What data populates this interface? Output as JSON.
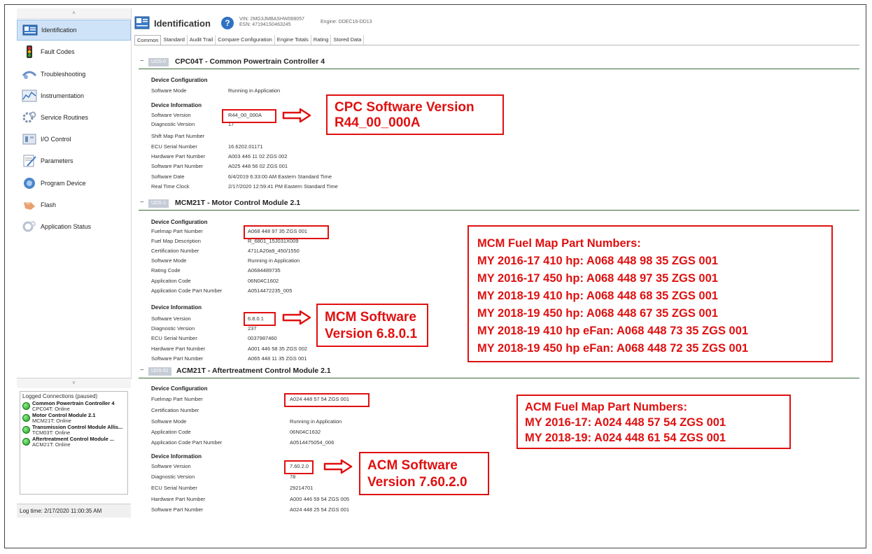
{
  "sidebar": {
    "items": [
      {
        "label": "Identification",
        "icon": "identification-icon",
        "active": true
      },
      {
        "label": "Fault Codes",
        "icon": "fault-codes-icon"
      },
      {
        "label": "Troubleshooting",
        "icon": "troubleshooting-icon"
      },
      {
        "label": "Instrumentation",
        "icon": "instrumentation-icon"
      },
      {
        "label": "Service Routines",
        "icon": "service-routines-icon"
      },
      {
        "label": "I/O Control",
        "icon": "io-control-icon"
      },
      {
        "label": "Parameters",
        "icon": "parameters-icon"
      },
      {
        "label": "Program Device",
        "icon": "program-device-icon"
      },
      {
        "label": "Flash",
        "icon": "flash-icon"
      },
      {
        "label": "Application Status",
        "icon": "application-status-icon"
      }
    ],
    "collapse_top": "˄",
    "collapse_bottom": "˅"
  },
  "connections": {
    "title": "Logged Connections (paused)",
    "items": [
      {
        "name": "Common Powertrain Controller 4",
        "status": "CPC04T: Online"
      },
      {
        "name": "Motor Control Module 2.1",
        "status": "MCM21T: Online"
      },
      {
        "name": "Transmission Control Module Allis...",
        "status": "TCM03T: Online"
      },
      {
        "name": "Aftertreatment Control Module ...",
        "status": "ACM21T: Online"
      }
    ]
  },
  "log_time": "Log time: 2/17/2020 11:00:35 AM",
  "header": {
    "title": "Identification",
    "help": "?",
    "vin": "VIN: 2MG3JMBASHW068057",
    "esn": "ESN: 471941S0463245",
    "engine": "Engine: DDEC16-DD13"
  },
  "tabs": [
    "Common",
    "Standard",
    "Audit Trail",
    "Compare Configuration",
    "Engine Totals",
    "Rating",
    "Stored Data"
  ],
  "cpc": {
    "minus": "−",
    "badge": "UDS-0",
    "title": "CPC04T - Common Powertrain Controller 4",
    "config_title": "Device Configuration",
    "config_rows": [
      {
        "label": "Software Mode",
        "value": "Running in Application"
      }
    ],
    "info_title": "Device Information",
    "info_rows": [
      {
        "label": "Software Version",
        "value": "R44_00_000A"
      },
      {
        "label": "Diagnostic Version",
        "value": "17"
      },
      {
        "label": "Shift Map Part Number",
        "value": ""
      },
      {
        "label": "ECU Serial Number",
        "value": "16.6202.01171"
      },
      {
        "label": "Hardware Part Number",
        "value": "A003 446 11 02 ZGS 002"
      },
      {
        "label": "Software Part Number",
        "value": "A025 448 56 02 ZGS 001"
      },
      {
        "label": "Software Date",
        "value": "6/4/2019 6:33:00 AM Eastern Standard Time"
      },
      {
        "label": "Real Time Clock",
        "value": "2/17/2020 12:59:41 PM Eastern Standard Time"
      }
    ]
  },
  "mcm": {
    "minus": "−",
    "badge": "UDS-1",
    "title": "MCM21T - Motor Control Module 2.1",
    "config_title": "Device Configuration",
    "config_rows": [
      {
        "label": "Fuelmap Part Number",
        "value": "A068 448 97 35 ZGS 001"
      },
      {
        "label": "Fuel Map Description",
        "value": "R_6801_15J031X009"
      },
      {
        "label": "Certification Number",
        "value": "471LA20a9_450/1550"
      },
      {
        "label": "Software Mode",
        "value": "Running in Application"
      },
      {
        "label": "Rating Code",
        "value": "A0684489735"
      },
      {
        "label": "Application Code",
        "value": "06N04C1602"
      },
      {
        "label": "Application Code Part Number",
        "value": "A0514472235_005"
      }
    ],
    "info_title": "Device Information",
    "info_rows": [
      {
        "label": "Software Version",
        "value": "6.8.0.1"
      },
      {
        "label": "Diagnostic Version",
        "value": "237"
      },
      {
        "label": "ECU Serial Number",
        "value": "0037987460"
      },
      {
        "label": "Hardware Part Number",
        "value": "A001 446 58 35 ZGS 002"
      },
      {
        "label": "Software Part Number",
        "value": "A065 448 11 35 ZGS 001"
      }
    ]
  },
  "acm": {
    "minus": "−",
    "badge": "UDS-61",
    "title": "ACM21T - Aftertreatment Control Module 2.1",
    "config_title": "Device Configuration",
    "config_rows": [
      {
        "label": "Fuelmap Part Number",
        "value": "A024 448 57 54 ZGS 001"
      },
      {
        "label": "Certification Number",
        "value": ""
      },
      {
        "label": "Software Mode",
        "value": "Running in Application"
      },
      {
        "label": "Application Code",
        "value": "06N04C1632"
      },
      {
        "label": "Application Code Part Number",
        "value": "A0514475054_006"
      }
    ],
    "info_title": "Device Information",
    "info_rows": [
      {
        "label": "Software Version",
        "value": "7.60.2.0"
      },
      {
        "label": "Diagnostic Version",
        "value": "78"
      },
      {
        "label": "ECU Serial Number",
        "value": "29214701"
      },
      {
        "label": "Hardware Part Number",
        "value": "A000 446 59 54 ZGS 005"
      },
      {
        "label": "Software Part Number",
        "value": "A024 448 25 54 ZGS 001"
      }
    ]
  },
  "callouts": {
    "cpc_sw": [
      "CPC Software Version",
      "R44_00_000A"
    ],
    "mcm_sw": [
      "MCM Software",
      "Version 6.8.0.1"
    ],
    "acm_sw": [
      "ACM Software",
      "Version 7.60.2.0"
    ],
    "mcm_fuel": [
      "MCM Fuel Map Part Numbers:",
      "MY 2016-17 410 hp: A068 448 98 35 ZGS 001",
      "MY 2016-17 450 hp: A068 448 97 35 ZGS 001",
      "MY 2018-19 410 hp:  A068 448 68 35 ZGS 001",
      "MY 2018-19 450 hp: A068 448 67 35 ZGS 001",
      "MY 2018-19 410 hp eFan:  A068 448 73 35 ZGS 001",
      "MY 2018-19 450 hp eFan: A068 448 72 35 ZGS 001"
    ],
    "acm_fuel": [
      "ACM Fuel Map Part Numbers:",
      "MY 2016-17: A024 448 57 54 ZGS 001",
      "MY 2018-19: A024 448 61 54 ZGS 001"
    ]
  },
  "colors": {
    "highlight": "#e01010",
    "accent": "#2e72c4",
    "online": "#1d9b1d"
  }
}
